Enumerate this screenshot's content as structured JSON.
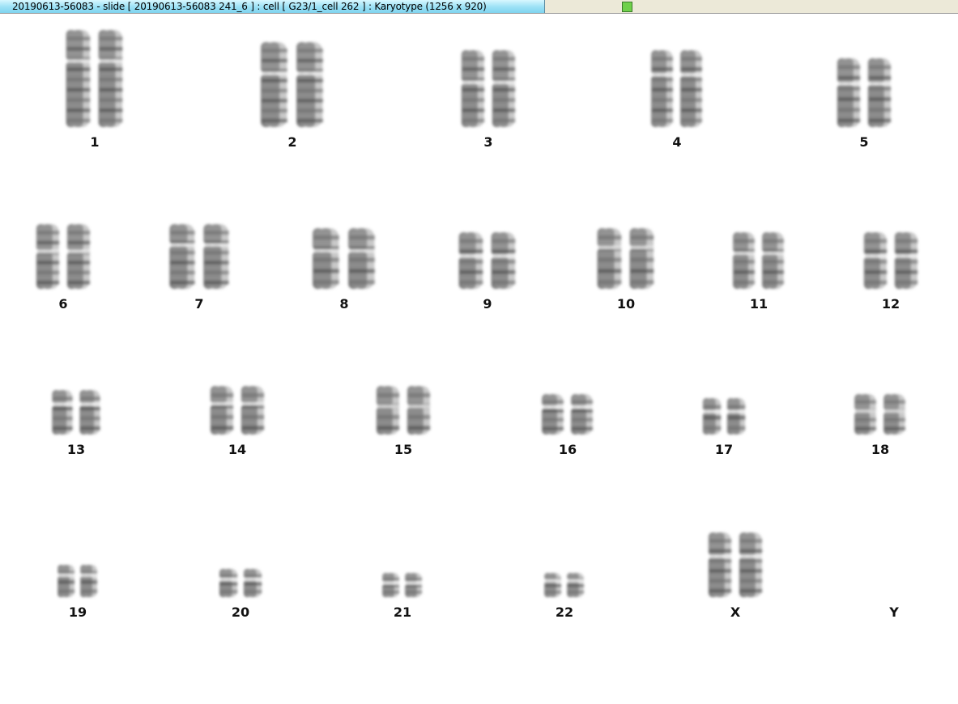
{
  "window": {
    "title": "20190613-56083 - slide [ 20190613-56083 241_6 ] : cell [ G23/1_cell 262 ] : Karyotype  (1256 x 920)",
    "status_color": "#6fd04a"
  },
  "karyotype": {
    "chromosomes": [
      {
        "label": "1"
      },
      {
        "label": "2"
      },
      {
        "label": "3"
      },
      {
        "label": "4"
      },
      {
        "label": "5"
      },
      {
        "label": "6"
      },
      {
        "label": "7"
      },
      {
        "label": "8"
      },
      {
        "label": "9"
      },
      {
        "label": "10"
      },
      {
        "label": "11"
      },
      {
        "label": "12"
      },
      {
        "label": "13"
      },
      {
        "label": "14"
      },
      {
        "label": "15"
      },
      {
        "label": "16"
      },
      {
        "label": "17"
      },
      {
        "label": "18"
      },
      {
        "label": "19"
      },
      {
        "label": "20"
      },
      {
        "label": "21"
      },
      {
        "label": "22"
      },
      {
        "label": "X"
      },
      {
        "label": "Y"
      }
    ]
  }
}
